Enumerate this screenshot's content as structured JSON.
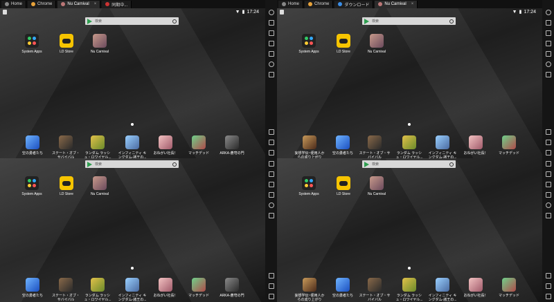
{
  "time": "17:24",
  "tabs_tl": [
    {
      "label": "Home",
      "color": "#888"
    },
    {
      "label": "Chrome",
      "color": "#e8a23a"
    },
    {
      "label": "Nu Carnival",
      "color": "#b77"
    },
    {
      "label": "同期中...",
      "color": "#c33"
    }
  ],
  "tabs_tr": [
    {
      "label": "Home",
      "color": "#888"
    },
    {
      "label": "Chrome",
      "color": "#e8a23a"
    },
    {
      "label": "ダウンロード",
      "color": "#3a8ee8"
    },
    {
      "label": "Nu Carnival",
      "color": "#b77"
    }
  ],
  "search_placeholder": "検索",
  "home_apps": [
    {
      "label": "System Apps"
    },
    {
      "label": "LD Store"
    },
    {
      "label": "Nu Carnival"
    }
  ],
  "dock_left": [
    "空の勇者たち",
    "ステート・オブ・\nサバイバル",
    "ランダム ラッシ\nュ・ロワイヤル...",
    "インフィニティ キ\nングダム-諸王の...",
    "おねがい社長！",
    "マッチデッド",
    "ARKA-蒼穹の門"
  ],
  "dock_right": [
    "妄想学伝~便用人か\nらの成り上がり",
    "空の勇者たち",
    "ステート・オブ・サ\nバイバル",
    "ランダム ラッシ\nュ・ロワイヤル...",
    "インフィニティ キ\nングダム-諸王の...",
    "おねがい社長！",
    "マッチデッド"
  ]
}
